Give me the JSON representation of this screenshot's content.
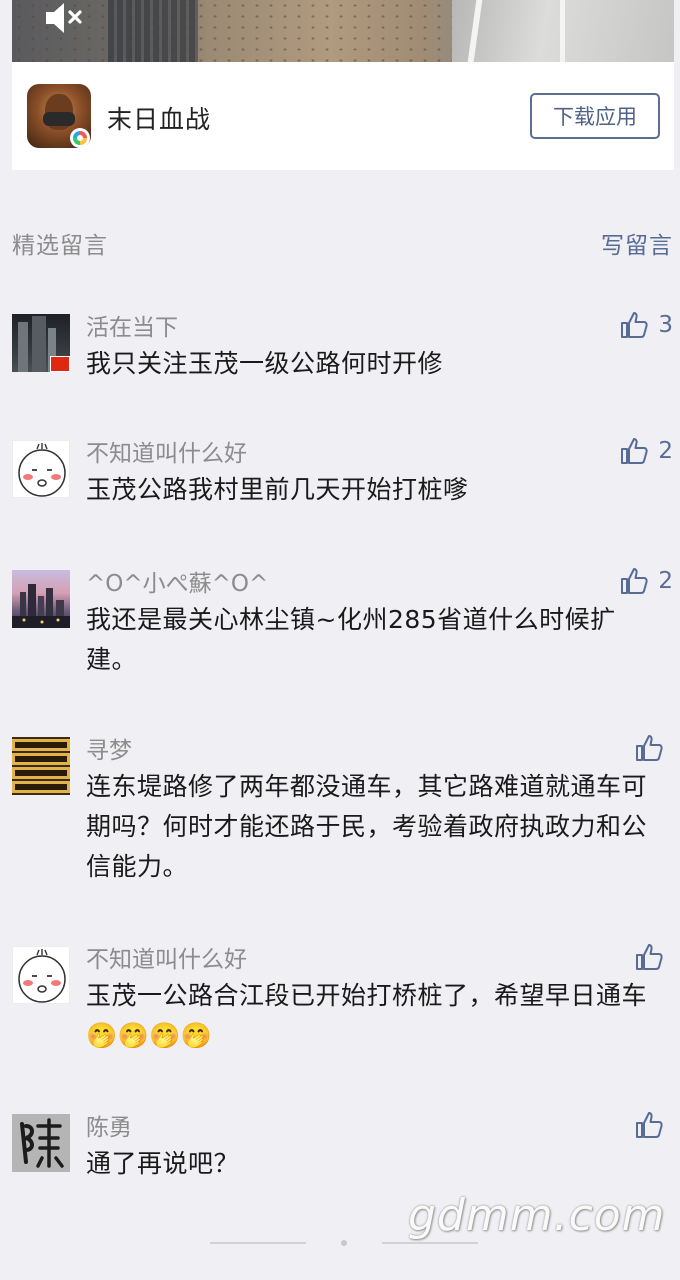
{
  "ad": {
    "app_name": "末日血战",
    "download_label": "下载应用"
  },
  "section": {
    "title": "精选留言",
    "write_label": "写留言"
  },
  "comments": [
    {
      "nickname": "活在当下",
      "content": "我只关注玉茂一级公路何时开修",
      "likes": "3",
      "avatar": "city-night-flag"
    },
    {
      "nickname": "不知道叫什么好",
      "content": "玉茂公路我村里前几天开始打桩嗲",
      "likes": "2",
      "avatar": "cartoon-face"
    },
    {
      "nickname": "^O^小ぺ蘇^O^",
      "content": "我还是最关心林尘镇~化州285省道什么时候扩建。",
      "likes": "2",
      "avatar": "city-skyline"
    },
    {
      "nickname": "寻梦",
      "content": "连东堤路修了两年都没通车，其它路难道就通车可期吗？何时才能还路于民，考验着政府执政力和公信能力。",
      "likes": "",
      "avatar": "gold-calligraphy"
    },
    {
      "nickname": "不知道叫什么好",
      "content": "玉茂一公路合江段已开始打桥桩了，希望早日通车",
      "emoji": "🤭🤭🤭🤭",
      "likes": "",
      "avatar": "cartoon-face"
    },
    {
      "nickname": "陈勇",
      "content": "通了再说吧？",
      "likes": "",
      "avatar": "ink-character"
    }
  ],
  "watermark": "gdmm.com",
  "colors": {
    "background": "#efeff4",
    "link": "#576b95",
    "secondary_text": "#8c8c8c"
  }
}
